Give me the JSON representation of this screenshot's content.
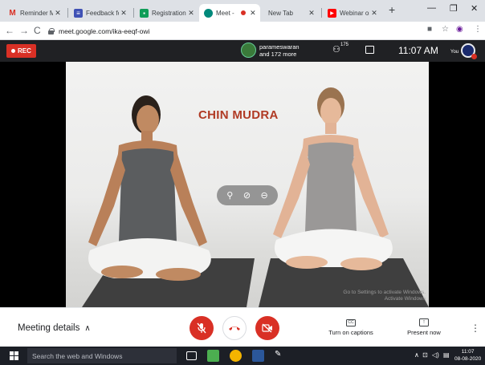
{
  "browser": {
    "tabs": [
      {
        "favicon": "gmail-m-icon",
        "title": "Reminder Mo",
        "favicon_color": "#d93025"
      },
      {
        "favicon": "forms-icon",
        "title": "Feedback fo",
        "favicon_color": "#3f51b5"
      },
      {
        "favicon": "classroom-icon",
        "title": "Registration",
        "favicon_color": "#0f9d58"
      },
      {
        "favicon": "meet-icon",
        "title": "Meet -",
        "favicon_color": "#00897b"
      },
      {
        "favicon": "",
        "title": "New Tab",
        "favicon_color": ""
      },
      {
        "favicon": "youtube-icon",
        "title": "Webinar on",
        "favicon_color": "#ff0000"
      }
    ],
    "new_tab_glyph": "+",
    "url": "meet.google.com/ika-eeqf-owi"
  },
  "meet": {
    "rec_label": "REC",
    "presenter_name": "parameswaran",
    "presenter_more": "and 172 more",
    "participant_count": "175",
    "time": "11:07 AM",
    "you_label": "You",
    "video_title": "CHIN MUDRA",
    "watermark_line1": "Activate Windows",
    "watermark_line2": "Go to Settings to activate Windows."
  },
  "bottom": {
    "meeting_details": "Meeting details",
    "captions_label": "Turn on captions",
    "captions_icon_text": "CC",
    "present_label": "Present now"
  },
  "taskbar": {
    "search_placeholder": "Search the web and Windows",
    "clock_time": "11:07",
    "clock_date": "08-08-2020"
  },
  "colors": {
    "meet_bar": "#202124",
    "rec_red": "#d93025",
    "title_text": "#b03a24"
  }
}
